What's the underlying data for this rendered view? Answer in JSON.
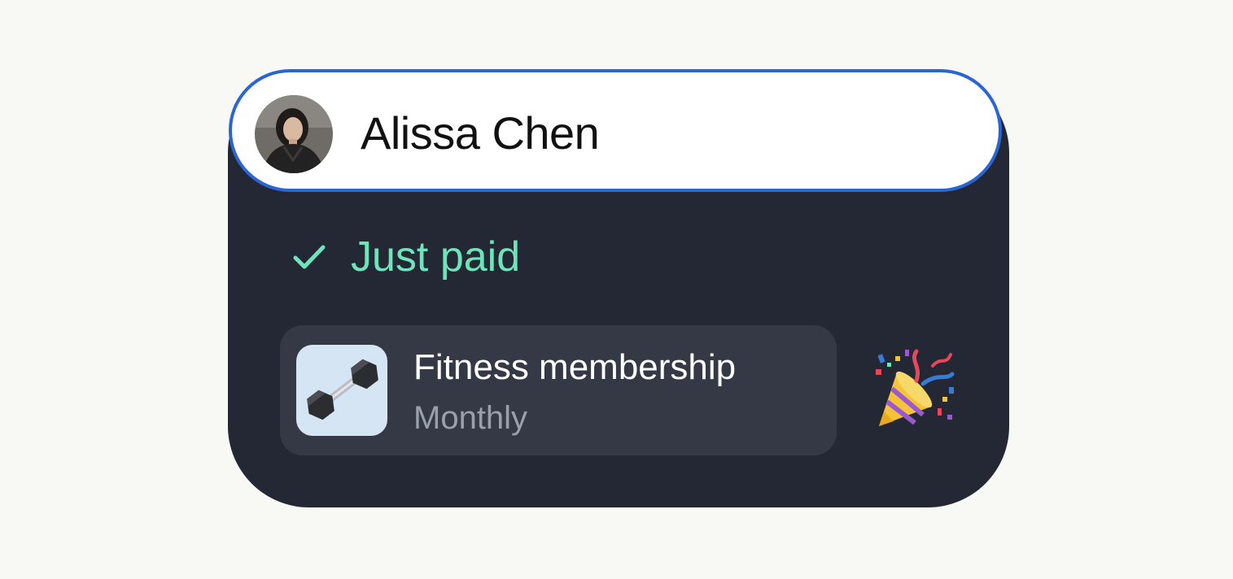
{
  "user": {
    "name": "Alissa Chen",
    "avatar_icon": "user-photo"
  },
  "status": {
    "icon": "check-icon",
    "label": "Just paid",
    "color": "#6fe3b9"
  },
  "item": {
    "icon": "dumbbell-icon",
    "title": "Fitness membership",
    "subtitle": "Monthly"
  },
  "celebration_icon": "party-popper-icon",
  "colors": {
    "card_background": "#232834",
    "pill_border": "#2a66d3",
    "item_background": "#343945",
    "thumb_background": "#d6e5f4"
  }
}
